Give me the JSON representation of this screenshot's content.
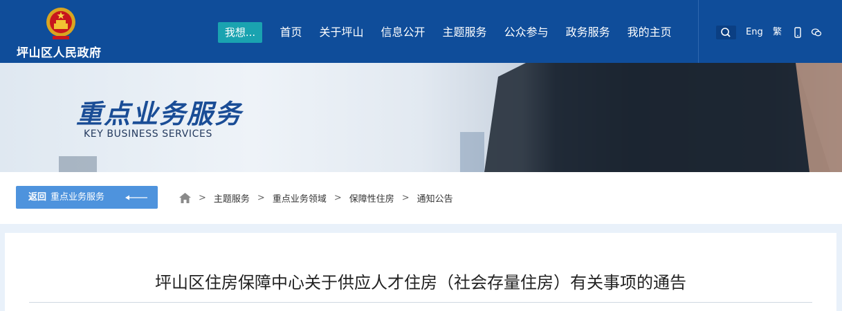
{
  "header": {
    "site_name": "坪山区人民政府",
    "wish_button": "我想...",
    "nav": [
      "首页",
      "关于坪山",
      "信息公开",
      "主题服务",
      "公众参与",
      "政务服务",
      "我的主页"
    ],
    "tools": {
      "eng": "Eng",
      "traditional": "繁"
    },
    "colors": {
      "header_bg": "#0f4d9a",
      "wish_bg": "#1aa3b0"
    }
  },
  "banner": {
    "title": "重点业务服务",
    "subtitle": "KEY BUSINESS SERVICES"
  },
  "back_button": {
    "prefix": "返回",
    "label": "重点业务服务"
  },
  "breadcrumb": [
    "主题服务",
    "重点业务领域",
    "保障性住房",
    "通知公告"
  ],
  "breadcrumb_separator": ">",
  "article": {
    "title": "坪山区住房保障中心关于供应人才住房（社会存量住房）有关事项的通告"
  },
  "icons": [
    "national-emblem-icon",
    "search-icon",
    "mobile-icon",
    "wechat-icon",
    "home-icon",
    "arrow-left-icon"
  ]
}
